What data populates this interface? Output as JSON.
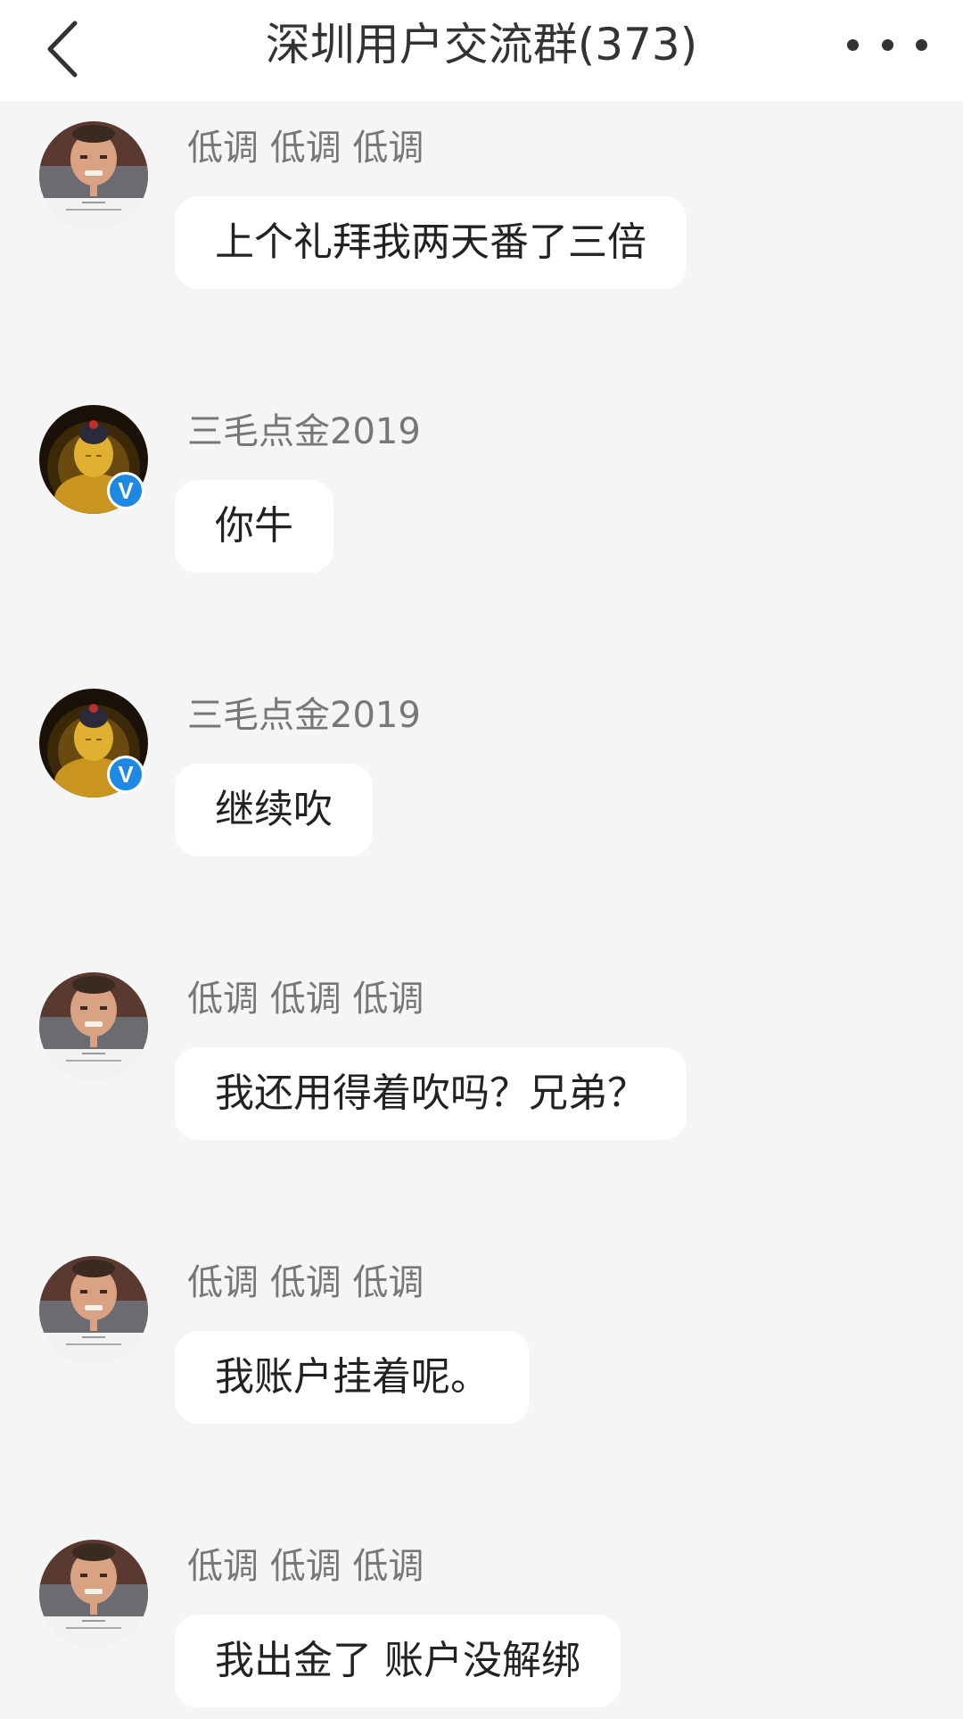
{
  "header": {
    "title": "深圳用户交流群(373)",
    "back_icon": "chevron-left-icon",
    "more_icon": "more-dots-icon"
  },
  "colors": {
    "background": "#f5f5f5",
    "bubble": "#ffffff",
    "verified_badge": "#1e88e5"
  },
  "messages": [
    {
      "sender": "低调 低调 低调",
      "avatar": "person-avatar",
      "verified": false,
      "text": "上个礼拜我两天番了三倍"
    },
    {
      "sender": "三毛点金2019",
      "avatar": "buddha-avatar",
      "verified": true,
      "badge": "V",
      "text": "你牛"
    },
    {
      "sender": "三毛点金2019",
      "avatar": "buddha-avatar",
      "verified": true,
      "badge": "V",
      "text": "继续吹"
    },
    {
      "sender": "低调 低调 低调",
      "avatar": "person-avatar",
      "verified": false,
      "text": "我还用得着吹吗？兄弟？"
    },
    {
      "sender": "低调 低调 低调",
      "avatar": "person-avatar",
      "verified": false,
      "text": "我账户挂着呢。"
    },
    {
      "sender": "低调 低调 低调",
      "avatar": "person-avatar",
      "verified": false,
      "text": "我出金了 账户没解绑"
    }
  ]
}
